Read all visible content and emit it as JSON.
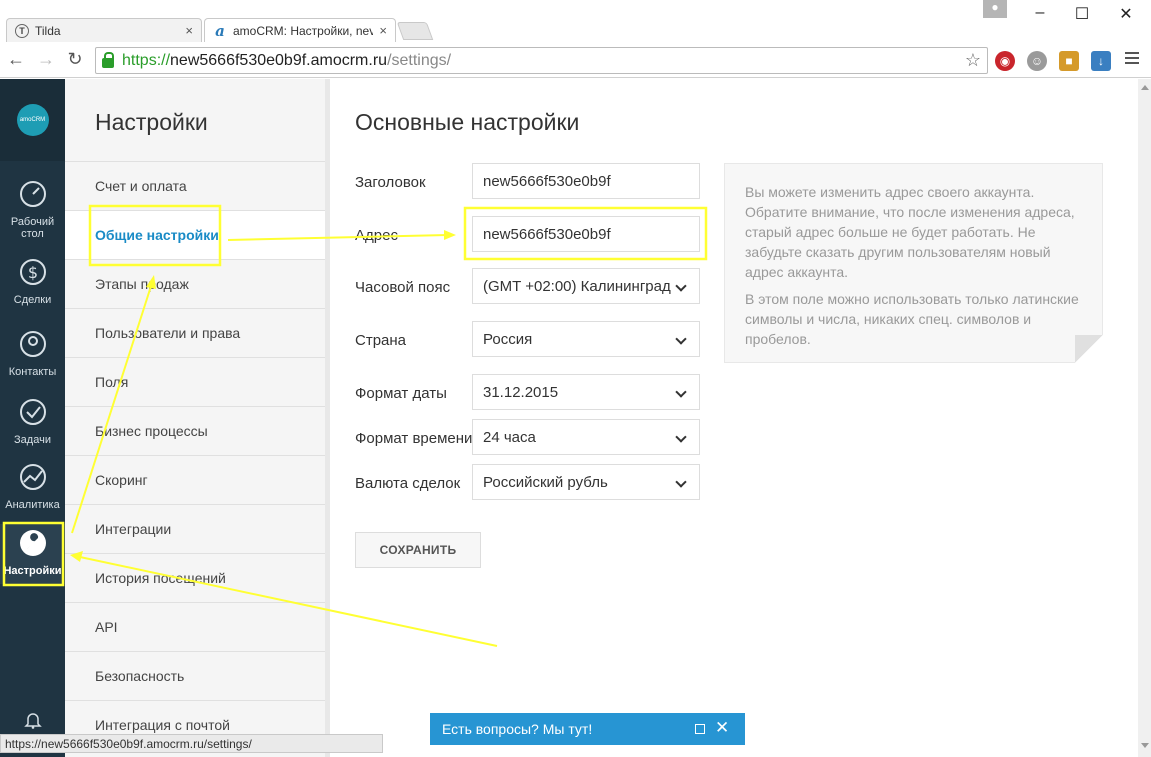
{
  "browser": {
    "tabs": [
      {
        "title": "Tilda",
        "close": "×"
      },
      {
        "title": "amoCRM: Настройки, nev",
        "close": "×"
      }
    ],
    "url": {
      "scheme": "https://",
      "host": "new5666f530e0b9f.amocrm.ru",
      "path": "/settings/"
    },
    "status_url": "https://new5666f530e0b9f.amocrm.ru/settings/"
  },
  "leftnav": {
    "logo": "amoCRM",
    "items": [
      {
        "label": "Рабочий стол",
        "icon": "dashboard-icon"
      },
      {
        "label": "Сделки",
        "icon": "dollar-icon"
      },
      {
        "label": "Контакты",
        "icon": "contact-icon"
      },
      {
        "label": "Задачи",
        "icon": "check-icon"
      },
      {
        "label": "Аналитика",
        "icon": "analytics-icon"
      },
      {
        "label": "Настройки",
        "icon": "wrench-icon"
      }
    ]
  },
  "submenu": {
    "title": "Настройки",
    "items": [
      "Счет и оплата",
      "Общие настройки",
      "Этапы продаж",
      "Пользователи и права",
      "Поля",
      "Бизнес процессы",
      "Скоринг",
      "Интеграции",
      "История посещений",
      "API",
      "Безопасность",
      "Интеграция с почтой"
    ],
    "active": "Общие настройки"
  },
  "main": {
    "title": "Основные настройки",
    "fields": {
      "title_label": "Заголовок",
      "title_value": "new5666f530e0b9f",
      "address_label": "Адрес",
      "address_value": "new5666f530e0b9f",
      "timezone_label": "Часовой пояс",
      "timezone_value": "(GMT +02:00) Калининград",
      "country_label": "Страна",
      "country_value": "Россия",
      "date_label": "Формат даты",
      "date_value": "31.12.2015",
      "time_label": "Формат времени",
      "time_value": "24 часа",
      "currency_label": "Валюта сделок",
      "currency_value": "Российский рубль"
    },
    "hint": {
      "p1": "Вы можете изменить адрес своего аккаунта. Обратите внимание, что после изменения адреса, старый адрес больше не будет работать. Не забудьте сказать другим пользователям новый адрес аккаунта.",
      "p2": "В этом поле можно использовать только латинские символы и числа, никаких спец. символов и пробелов."
    },
    "save_label": "СОХРАНИТЬ"
  },
  "chat": {
    "label": "Есть вопросы? Мы тут!",
    "close": "✕"
  },
  "colors": {
    "accent": "#1a8bc6",
    "annotation": "#ffff33",
    "sidebar": "#1f3442"
  }
}
